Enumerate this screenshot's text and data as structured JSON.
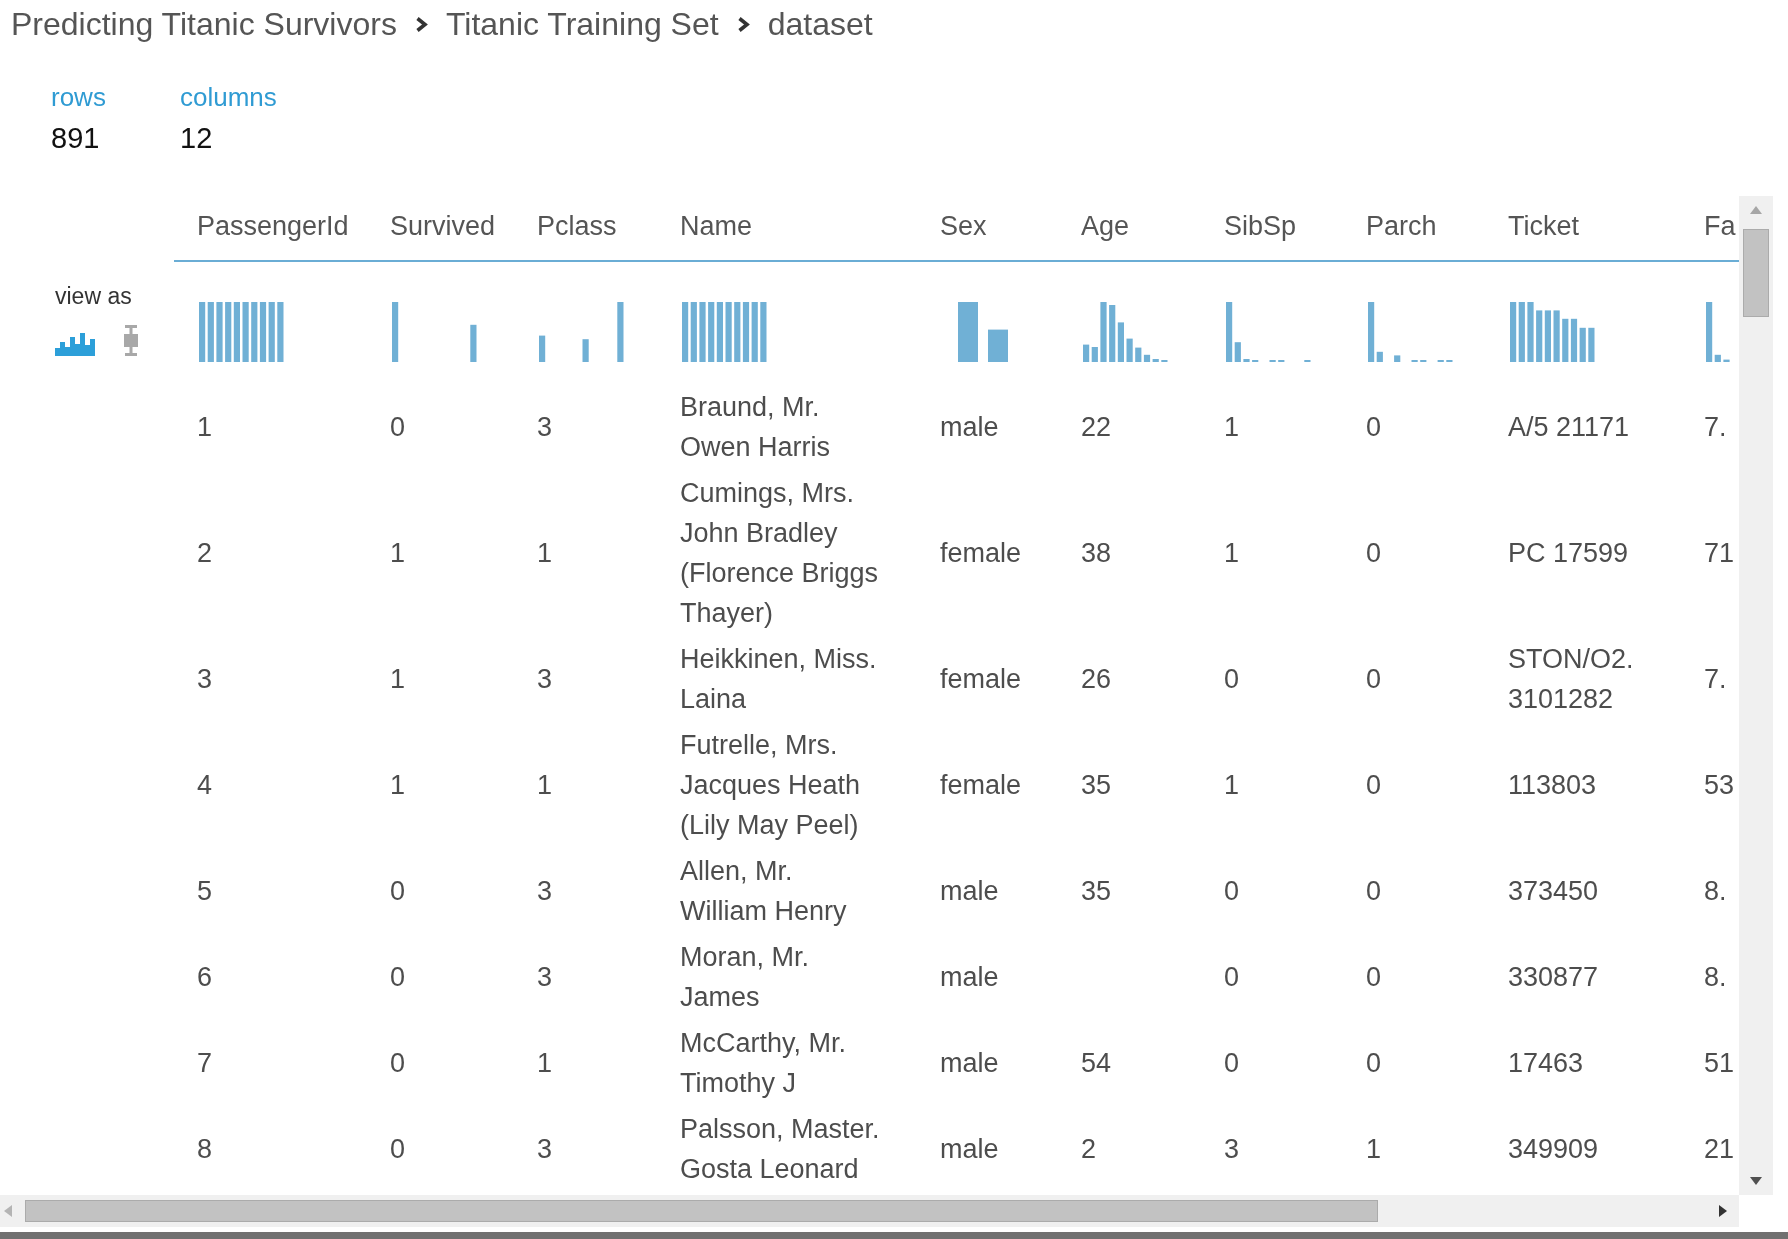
{
  "breadcrumb": [
    {
      "label": "Predicting Titanic Survivors"
    },
    {
      "label": "Titanic Training Set"
    },
    {
      "label": "dataset"
    }
  ],
  "stats": [
    {
      "label": "rows",
      "value": "891"
    },
    {
      "label": "columns",
      "value": "12"
    }
  ],
  "view_as": {
    "label": "view as",
    "options": [
      {
        "kind": "histogram",
        "selected": true
      },
      {
        "kind": "boxplot",
        "selected": false
      }
    ]
  },
  "table": {
    "columns": [
      "PassengerId",
      "Survived",
      "Pclass",
      "Name",
      "Sex",
      "Age",
      "SibSp",
      "Parch",
      "Ticket",
      "Fa"
    ],
    "rows": [
      [
        "1",
        "0",
        "3",
        "Braund, Mr. Owen Harris",
        "male",
        "22",
        "1",
        "0",
        "A/5 21171",
        "7."
      ],
      [
        "2",
        "1",
        "1",
        "Cumings, Mrs. John Bradley (Florence Briggs Thayer)",
        "female",
        "38",
        "1",
        "0",
        "PC 17599",
        "71"
      ],
      [
        "3",
        "1",
        "3",
        "Heikkinen, Miss. Laina",
        "female",
        "26",
        "0",
        "0",
        "STON/O2. 3101282",
        "7."
      ],
      [
        "4",
        "1",
        "1",
        "Futrelle, Mrs. Jacques Heath (Lily May Peel)",
        "female",
        "35",
        "1",
        "0",
        "113803",
        "53"
      ],
      [
        "5",
        "0",
        "3",
        "Allen, Mr. William Henry",
        "male",
        "35",
        "0",
        "0",
        "373450",
        "8."
      ],
      [
        "6",
        "0",
        "3",
        "Moran, Mr. James",
        "male",
        null,
        "0",
        "0",
        "330877",
        "8."
      ],
      [
        "7",
        "0",
        "1",
        "McCarthy, Mr. Timothy J",
        "male",
        "54",
        "0",
        "0",
        "17463",
        "51"
      ],
      [
        "8",
        "0",
        "3",
        "Palsson, Master. Gosta Leonard",
        "male",
        "2",
        "3",
        "1",
        "349909",
        "21"
      ]
    ]
  }
}
